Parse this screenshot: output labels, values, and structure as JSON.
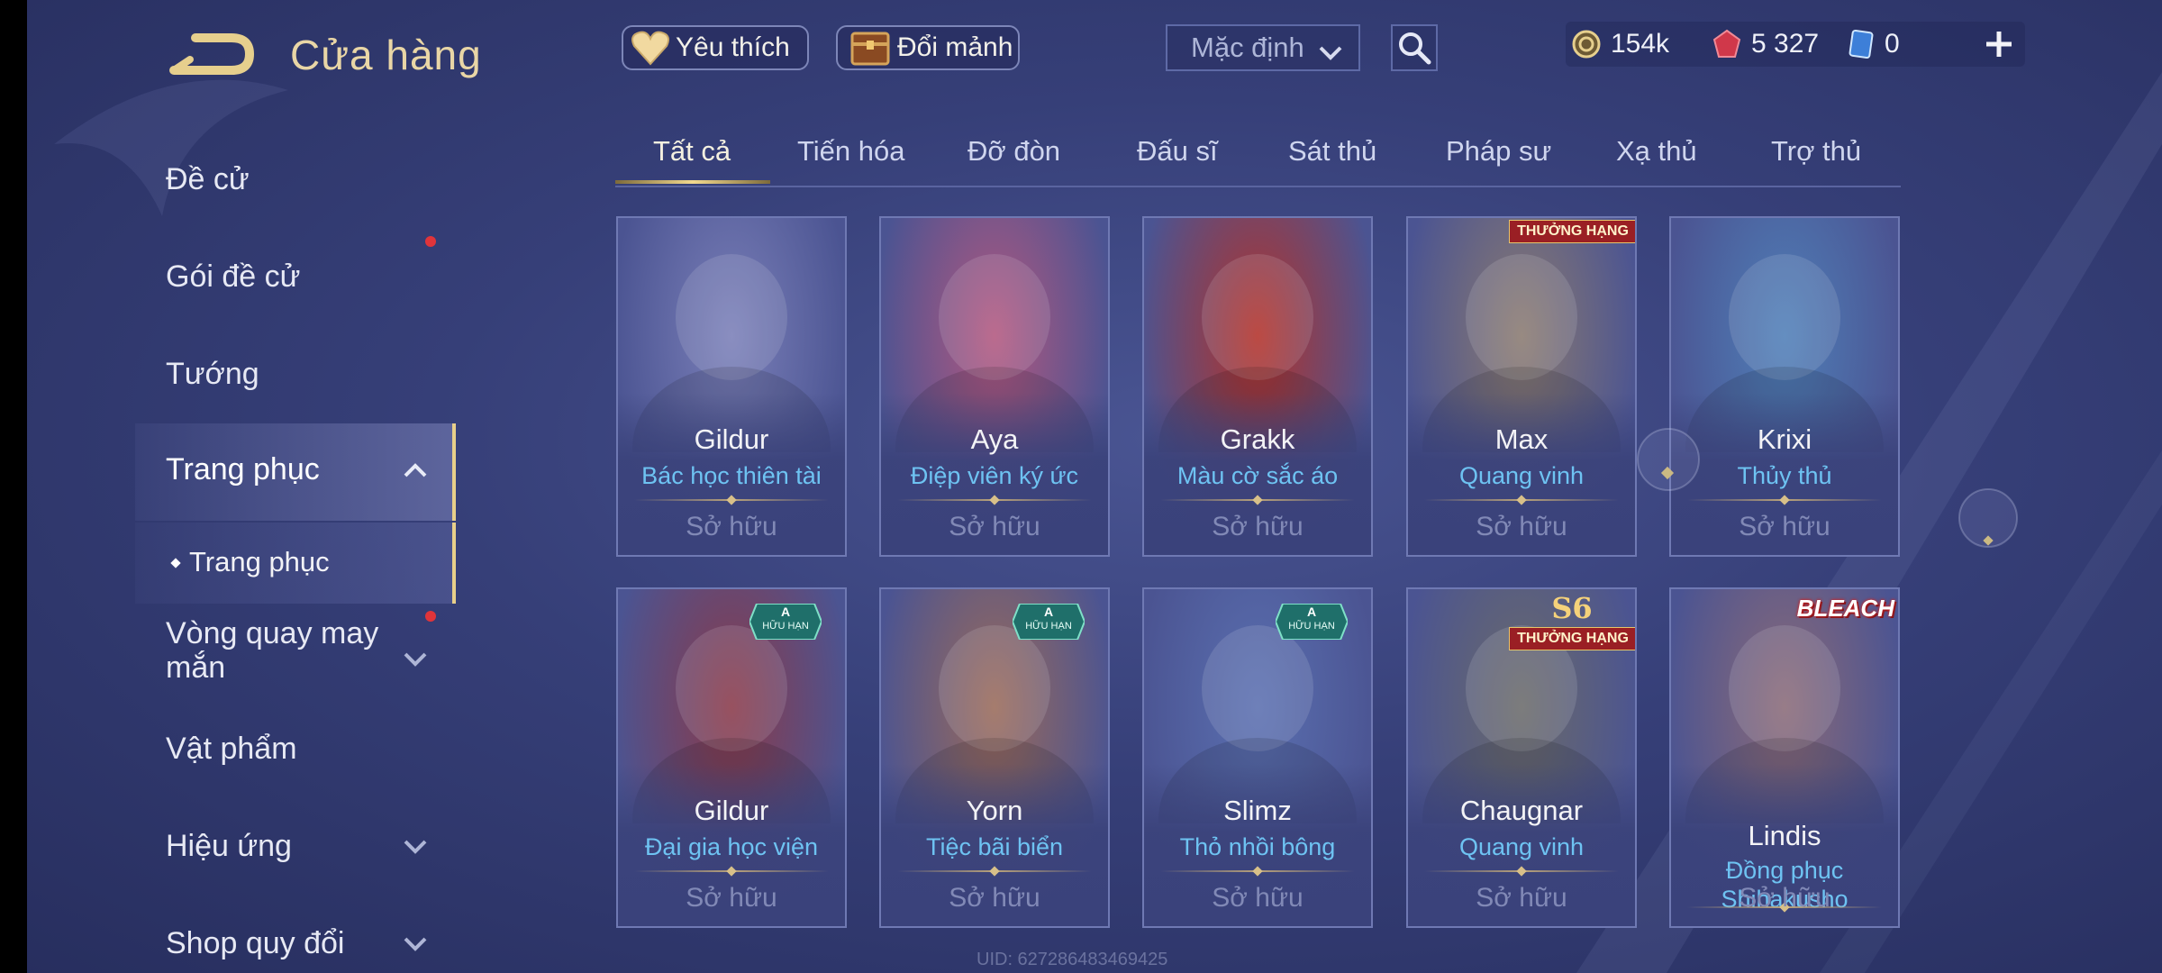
{
  "header": {
    "title": "Cửa hàng",
    "favorites_label": "Yêu thích",
    "fragments_label": "Đổi mảnh",
    "sort_value": "Mặc định"
  },
  "currencies": {
    "gold": "154k",
    "ruby": "5 327",
    "voucher": "0"
  },
  "sidebar": {
    "items": [
      {
        "label": "Đề cử"
      },
      {
        "label": "Gói đề cử"
      },
      {
        "label": "Tướng"
      },
      {
        "label": "Trang phục"
      },
      {
        "label": "Trang phục"
      },
      {
        "label": "Vòng quay may mắn"
      },
      {
        "label": "Vật phẩm"
      },
      {
        "label": "Hiệu ứng"
      },
      {
        "label": "Shop quy đổi"
      }
    ]
  },
  "tabs": [
    "Tất cả",
    "Tiến hóa",
    "Đỡ đòn",
    "Đấu sĩ",
    "Sát thủ",
    "Pháp sư",
    "Xạ thủ",
    "Trợ thủ"
  ],
  "cards": [
    {
      "hero": "Gildur",
      "skin": "Bác học thiên tài",
      "status": "Sở hữu",
      "badge": "",
      "art_color": "#7a7fb8"
    },
    {
      "hero": "Aya",
      "skin": "Điệp viên ký ức",
      "status": "Sở hữu",
      "badge": "",
      "art_color": "#b2577f"
    },
    {
      "hero": "Grakk",
      "skin": "Màu cờ sắc áo",
      "status": "Sở hữu",
      "badge": "",
      "art_color": "#b3322a"
    },
    {
      "hero": "Max",
      "skin": "Quang vinh",
      "status": "Sở hữu",
      "badge": "THƯỞNG HẠNG",
      "art_color": "#8a7a70"
    },
    {
      "hero": "Krixi",
      "skin": "Thủy thủ",
      "status": "Sở hữu",
      "badge": "",
      "art_color": "#4f7fb8"
    },
    {
      "hero": "Gildur",
      "skin": "Đại gia học viện",
      "status": "Sở hữu",
      "badge": "HỮU HẠN",
      "art_color": "#8a3a4a"
    },
    {
      "hero": "Yorn",
      "skin": "Tiệc bãi biển",
      "status": "Sở hữu",
      "badge": "HỮU HẠN",
      "art_color": "#9a6a5a"
    },
    {
      "hero": "Slimz",
      "skin": "Thỏ nhồi bông",
      "status": "Sở hữu",
      "badge": "HỮU HẠN",
      "art_color": "#5a6fb0"
    },
    {
      "hero": "Chaugnar",
      "skin": "Quang vinh",
      "status": "Sở hữu",
      "badge": "THƯỞNG HẠNG",
      "art_color": "#6a6a6a"
    },
    {
      "hero": "Lindis",
      "skin": "Đồng phục Shihakusho",
      "status": "Sở hữu",
      "badge": "BLEACH",
      "art_color": "#8a6a78"
    }
  ],
  "badges": {
    "limited_letter": "A",
    "limited_text": "HỮU HẠN",
    "rank_text": "THƯỞNG HẠNG",
    "rank_season": "S6",
    "collab_text": "BLEACH"
  },
  "uid": "UID: 627286483469425",
  "colors": {
    "accent_gold": "#e8cf8a",
    "skin_name": "#6ec3f2",
    "notification": "#e0343a"
  }
}
